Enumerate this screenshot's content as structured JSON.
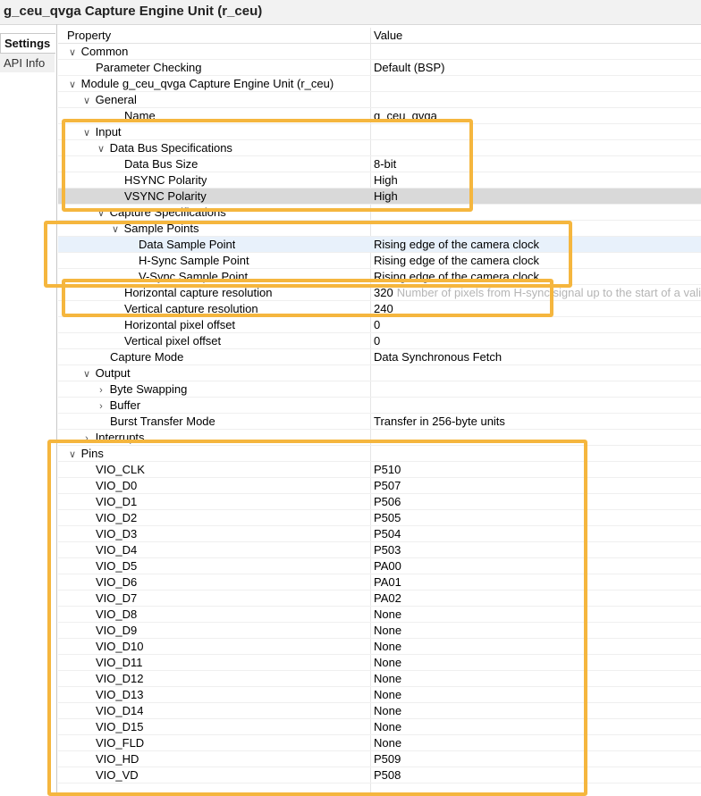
{
  "window": {
    "title": "g_ceu_qvga Capture Engine Unit (r_ceu)"
  },
  "side_tabs": [
    {
      "label": "Settings"
    },
    {
      "label": "API Info"
    }
  ],
  "table": {
    "headers": {
      "property": "Property",
      "value": "Value"
    },
    "rows": [
      {
        "label": "Common",
        "value": "",
        "level": 0,
        "toggle": "expanded"
      },
      {
        "label": "Parameter Checking",
        "value": "Default (BSP)",
        "level": 1,
        "toggle": "none"
      },
      {
        "label": "Module g_ceu_qvga Capture Engine Unit (r_ceu)",
        "value": "",
        "level": 0,
        "toggle": "expanded"
      },
      {
        "label": "General",
        "value": "",
        "level": 1,
        "toggle": "expanded"
      },
      {
        "label": "Name",
        "value": "g_ceu_qvga",
        "level": 3,
        "toggle": "none"
      },
      {
        "label": "Input",
        "value": "",
        "level": 1,
        "toggle": "expanded"
      },
      {
        "label": "Data Bus Specifications",
        "value": "",
        "level": 2,
        "toggle": "expanded"
      },
      {
        "label": "Data Bus Size",
        "value": "8-bit",
        "level": 3,
        "toggle": "none"
      },
      {
        "label": "HSYNC Polarity",
        "value": "High",
        "level": 3,
        "toggle": "none"
      },
      {
        "label": "VSYNC Polarity",
        "value": "High",
        "level": 3,
        "toggle": "none",
        "selected": "gray"
      },
      {
        "label": "Capture Specifications",
        "value": "",
        "level": 2,
        "toggle": "expanded"
      },
      {
        "label": "Sample Points",
        "value": "",
        "level": 3,
        "toggle": "expanded"
      },
      {
        "label": "Data Sample Point",
        "value": "Rising edge of the camera clock",
        "level": 4,
        "toggle": "none",
        "selected": "blue"
      },
      {
        "label": "H-Sync Sample Point",
        "value": "Rising edge of the camera clock",
        "level": 4,
        "toggle": "none"
      },
      {
        "label": "V-Sync Sample Point",
        "value": "Rising edge of the camera clock",
        "level": 4,
        "toggle": "none"
      },
      {
        "label": "Horizontal capture resolution",
        "value": "320",
        "level": 3,
        "toggle": "none",
        "hint": "Number of pixels from H-sync signal up to the start of a valid"
      },
      {
        "label": "Vertical capture resolution",
        "value": "240",
        "level": 3,
        "toggle": "none"
      },
      {
        "label": "Horizontal pixel offset",
        "value": "0",
        "level": 3,
        "toggle": "none"
      },
      {
        "label": "Vertical pixel offset",
        "value": "0",
        "level": 3,
        "toggle": "none"
      },
      {
        "label": "Capture Mode",
        "value": "Data Synchronous Fetch",
        "level": 2,
        "toggle": "none"
      },
      {
        "label": "Output",
        "value": "",
        "level": 1,
        "toggle": "expanded"
      },
      {
        "label": "Byte Swapping",
        "value": "",
        "level": 2,
        "toggle": "collapsed"
      },
      {
        "label": "Buffer",
        "value": "",
        "level": 2,
        "toggle": "collapsed"
      },
      {
        "label": "Burst Transfer Mode",
        "value": "Transfer in 256-byte units",
        "level": 2,
        "toggle": "none"
      },
      {
        "label": "Interrupts",
        "value": "",
        "level": 1,
        "toggle": "collapsed"
      },
      {
        "label": "Pins",
        "value": "",
        "level": 0,
        "toggle": "expanded"
      },
      {
        "label": "VIO_CLK",
        "value": "P510",
        "level": 1,
        "toggle": "none"
      },
      {
        "label": "VIO_D0",
        "value": "P507",
        "level": 1,
        "toggle": "none"
      },
      {
        "label": "VIO_D1",
        "value": "P506",
        "level": 1,
        "toggle": "none"
      },
      {
        "label": "VIO_D2",
        "value": "P505",
        "level": 1,
        "toggle": "none"
      },
      {
        "label": "VIO_D3",
        "value": "P504",
        "level": 1,
        "toggle": "none"
      },
      {
        "label": "VIO_D4",
        "value": "P503",
        "level": 1,
        "toggle": "none"
      },
      {
        "label": "VIO_D5",
        "value": "PA00",
        "level": 1,
        "toggle": "none"
      },
      {
        "label": "VIO_D6",
        "value": "PA01",
        "level": 1,
        "toggle": "none"
      },
      {
        "label": "VIO_D7",
        "value": "PA02",
        "level": 1,
        "toggle": "none"
      },
      {
        "label": "VIO_D8",
        "value": "None",
        "level": 1,
        "toggle": "none"
      },
      {
        "label": "VIO_D9",
        "value": "None",
        "level": 1,
        "toggle": "none"
      },
      {
        "label": "VIO_D10",
        "value": "None",
        "level": 1,
        "toggle": "none"
      },
      {
        "label": "VIO_D11",
        "value": "None",
        "level": 1,
        "toggle": "none"
      },
      {
        "label": "VIO_D12",
        "value": "None",
        "level": 1,
        "toggle": "none"
      },
      {
        "label": "VIO_D13",
        "value": "None",
        "level": 1,
        "toggle": "none"
      },
      {
        "label": "VIO_D14",
        "value": "None",
        "level": 1,
        "toggle": "none"
      },
      {
        "label": "VIO_D15",
        "value": "None",
        "level": 1,
        "toggle": "none"
      },
      {
        "label": "VIO_FLD",
        "value": "None",
        "level": 1,
        "toggle": "none"
      },
      {
        "label": "VIO_HD",
        "value": "P509",
        "level": 1,
        "toggle": "none"
      },
      {
        "label": "VIO_VD",
        "value": "P508",
        "level": 1,
        "toggle": "none"
      }
    ]
  },
  "colors": {
    "highlight": "#f5b63e",
    "selected_gray": "#d9d9d9",
    "selected_blue": "#e8f1fb"
  },
  "icons": {
    "expanded": "chevron-down-icon",
    "collapsed": "chevron-right-icon"
  }
}
